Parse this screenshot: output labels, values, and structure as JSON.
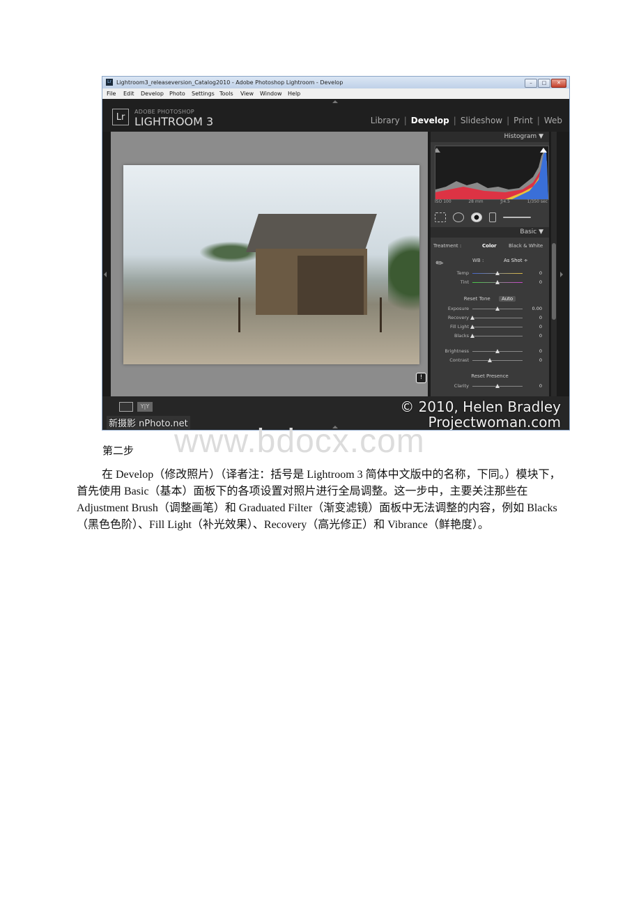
{
  "window": {
    "title": "Lightroom3_releaseversion_Catalog2010 - Adobe Photoshop Lightroom - Develop",
    "app_icon": "Lr",
    "menu": [
      "File",
      "Edit",
      "Develop",
      "Photo",
      "Settings",
      "Tools",
      "View",
      "Window",
      "Help"
    ],
    "controls": {
      "min": "–",
      "max": "□",
      "close": "✕"
    }
  },
  "lightroom": {
    "logo": "Lr",
    "brand_small": "ADOBE PHOTOSHOP",
    "brand_big": "LIGHTROOM 3",
    "modules": [
      {
        "label": "Library",
        "active": false
      },
      {
        "label": "Develop",
        "active": true
      },
      {
        "label": "Slideshow",
        "active": false
      },
      {
        "label": "Print",
        "active": false
      },
      {
        "label": "Web",
        "active": false
      }
    ],
    "module_sep": "|"
  },
  "panel": {
    "histogram_title": "Histogram ▼",
    "exif": [
      "ISO 100",
      "28 mm",
      "ƒ/4.5",
      "1/350 sec"
    ],
    "basic_title": "Basic ▼",
    "treatment_label": "Treatment :",
    "treatment_color": "Color",
    "treatment_bw": "Black & White",
    "wb_label": "WB :",
    "wb_value": "As Shot ÷",
    "temp": {
      "label": "Temp",
      "value": "0",
      "pos": 0.5
    },
    "tint": {
      "label": "Tint",
      "value": "0",
      "pos": 0.5
    },
    "reset_tone": "Reset Tone",
    "auto": "Auto",
    "exposure": {
      "label": "Exposure",
      "value": "0.00",
      "pos": 0.5
    },
    "recovery": {
      "label": "Recovery",
      "value": "0",
      "pos": 0
    },
    "fill_light": {
      "label": "Fill Light",
      "value": "0",
      "pos": 0
    },
    "blacks": {
      "label": "Blacks",
      "value": "0",
      "pos": 0
    },
    "brightness": {
      "label": "Brightness",
      "value": "0",
      "pos": 0.5
    },
    "contrast": {
      "label": "Contrast",
      "value": "0",
      "pos": 0.35
    },
    "reset_presence": "Reset Presence",
    "clarity": {
      "label": "Clarity",
      "value": "0",
      "pos": 0.5
    }
  },
  "overlay": {
    "copyright_line1": "© 2010, Helen Bradley",
    "copyright_line2": "Projectwoman.com",
    "watermark_small": "新摄影 nPhoto.net",
    "info_icon": "!"
  },
  "document": {
    "step_caption": "第二步",
    "site_watermark": "www.bdocx.com",
    "paragraph": "在 Develop（修改照片）（译者注：括号是 Lightroom 3 简体中文版中的名称，下同。）模块下，首先使用 Basic（基本）面板下的各项设置对照片进行全局调整。这一步中，主要关注那些在 Adjustment Brush（调整画笔）和 Graduated Filter（渐变滤镜）面板中无法调整的内容，例如 Blacks（黑色色阶）、Fill Light（补光效果）、Recovery（高光修正）和 Vibrance（鲜艳度）。"
  }
}
